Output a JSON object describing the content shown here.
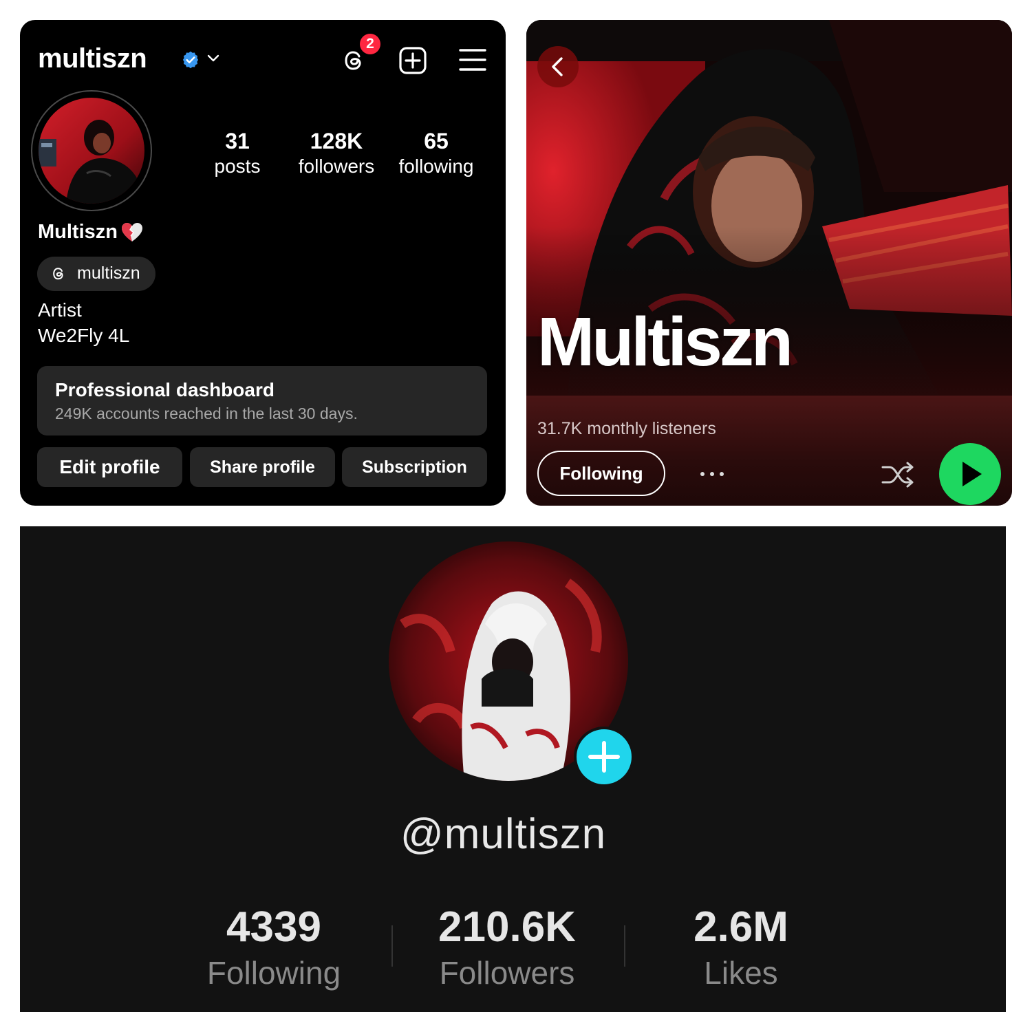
{
  "instagram": {
    "username": "multiszn",
    "notification_count": "2",
    "stats": [
      {
        "value": "31",
        "label": "posts"
      },
      {
        "value": "128K",
        "label": "followers"
      },
      {
        "value": "65",
        "label": "following"
      }
    ],
    "display_name": "Multiszn",
    "threads_handle": "multiszn",
    "bio_line1": "Artist",
    "bio_line2": "We2Fly 4L",
    "dashboard_title": "Professional dashboard",
    "dashboard_subtitle": "249K accounts reached in the last 30 days.",
    "buttons": {
      "edit": "Edit profile",
      "share": "Share profile",
      "subscription": "Subscription"
    },
    "colors": {
      "background": "#000000",
      "card": "#262626",
      "verified": "#3897f0",
      "badge": "#ff2741"
    }
  },
  "spotify": {
    "artist_name": "Multiszn",
    "monthly_listeners": "31.7K monthly listeners",
    "follow_label": "Following",
    "colors": {
      "play": "#1ed760",
      "header": "#4a1515"
    }
  },
  "tiktok": {
    "handle": "@multiszn",
    "stats": [
      {
        "value": "4339",
        "label": "Following"
      },
      {
        "value": "210.6K",
        "label": "Followers"
      },
      {
        "value": "2.6M",
        "label": "Likes"
      }
    ],
    "colors": {
      "background": "#121212",
      "plus": "#20d5ec"
    }
  }
}
